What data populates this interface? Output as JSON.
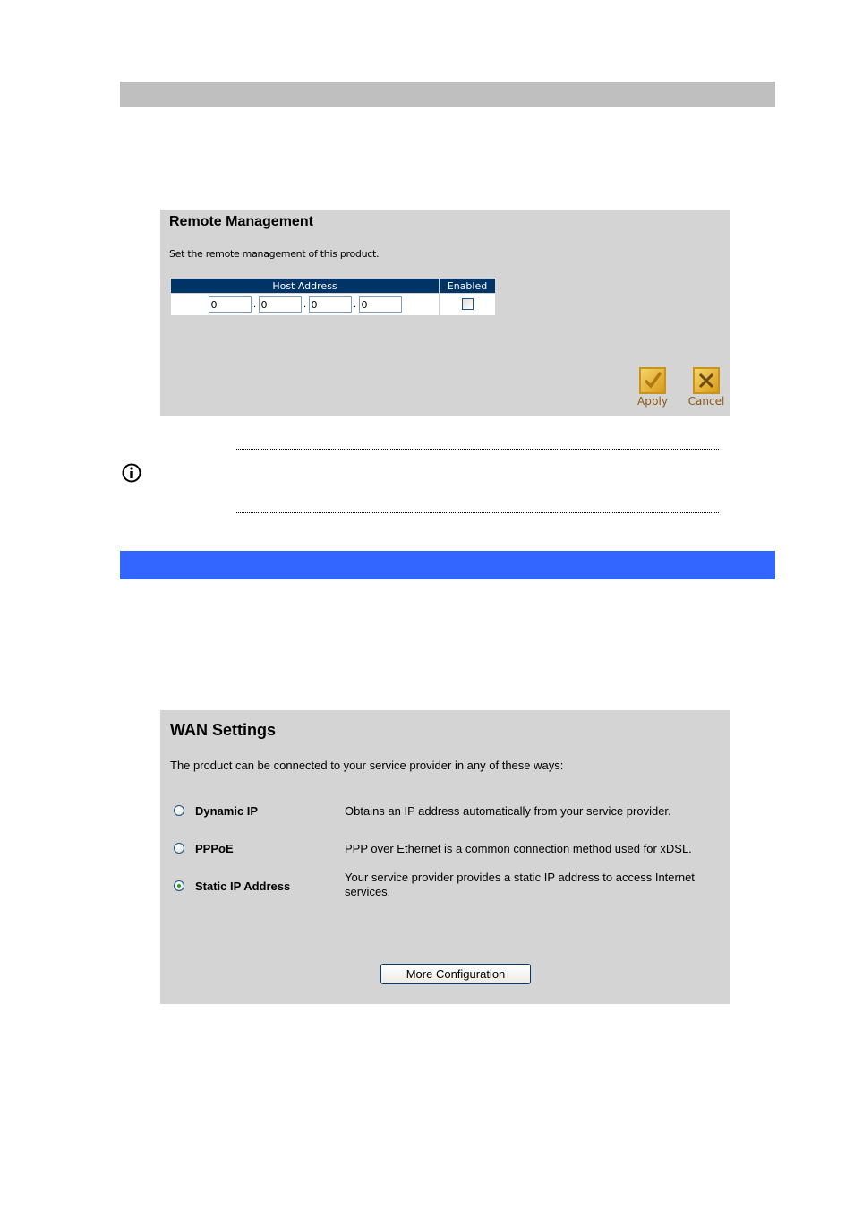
{
  "colors": {
    "gray_bar": "#bfbfbf",
    "blue_bar": "#3366ff",
    "panel_bg": "#d4d4d4",
    "table_header": "#003366"
  },
  "remote_management": {
    "title": "Remote Management",
    "description": "Set the remote management of this product.",
    "table": {
      "headers": [
        "Host Address",
        "Enabled"
      ],
      "ip_octets": [
        "0",
        "0",
        "0",
        "0"
      ],
      "enabled": false
    },
    "buttons": {
      "apply": "Apply",
      "cancel": "Cancel"
    }
  },
  "note": {
    "icon": "info-icon"
  },
  "wan_settings": {
    "title": "WAN Settings",
    "description": "The product can be connected to your service provider in any of these ways:",
    "options": [
      {
        "label": "Dynamic IP",
        "description": "Obtains an IP address automatically from your service provider.",
        "selected": false
      },
      {
        "label": "PPPoE",
        "description": "PPP over Ethernet is a common connection method used for xDSL.",
        "selected": false
      },
      {
        "label": "Static IP Address",
        "description": "Your service provider provides a static IP address to access Internet services.",
        "selected": true
      }
    ],
    "more_button": "More Configuration"
  }
}
